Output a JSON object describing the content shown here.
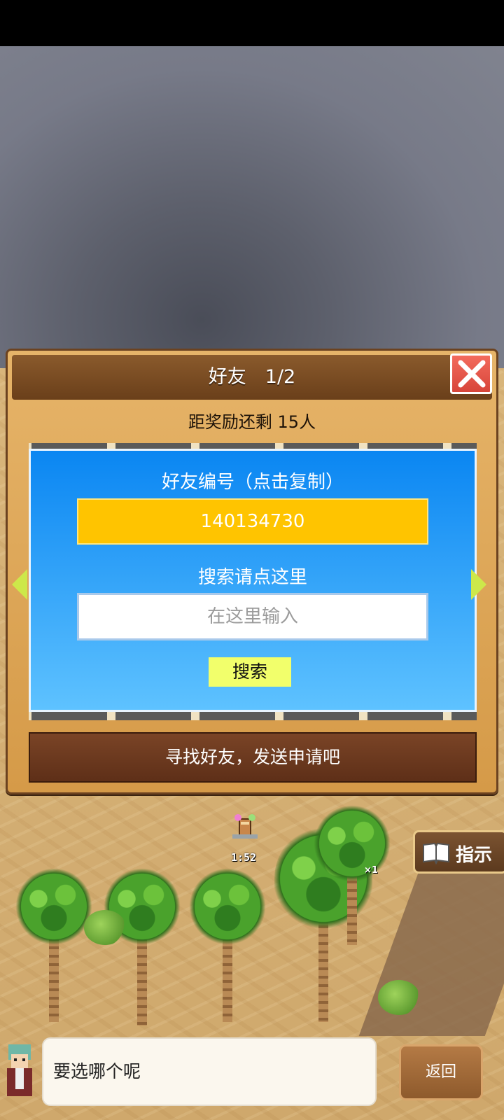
{
  "dialog": {
    "title": "好友　1/2",
    "reward_text": "距奖励还剩 15人",
    "friend_id_label": "好友编号（点击复制）",
    "friend_id": "140134730",
    "search_label": "搜索请点这里",
    "search_placeholder": "在这里输入",
    "search_button": "搜索",
    "bottom_message": "寻找好友，发送申请吧"
  },
  "hud": {
    "hint_label": "指示",
    "timer": "1:52",
    "multiplier": "×1"
  },
  "speech": {
    "text": "要选哪个呢"
  },
  "back_button": "返回",
  "colors": {
    "panel_blue": "#0a86f2",
    "friend_id_bg": "#ffc400",
    "search_btn_bg": "#f2ff6b",
    "close_btn": "#d7453a"
  }
}
